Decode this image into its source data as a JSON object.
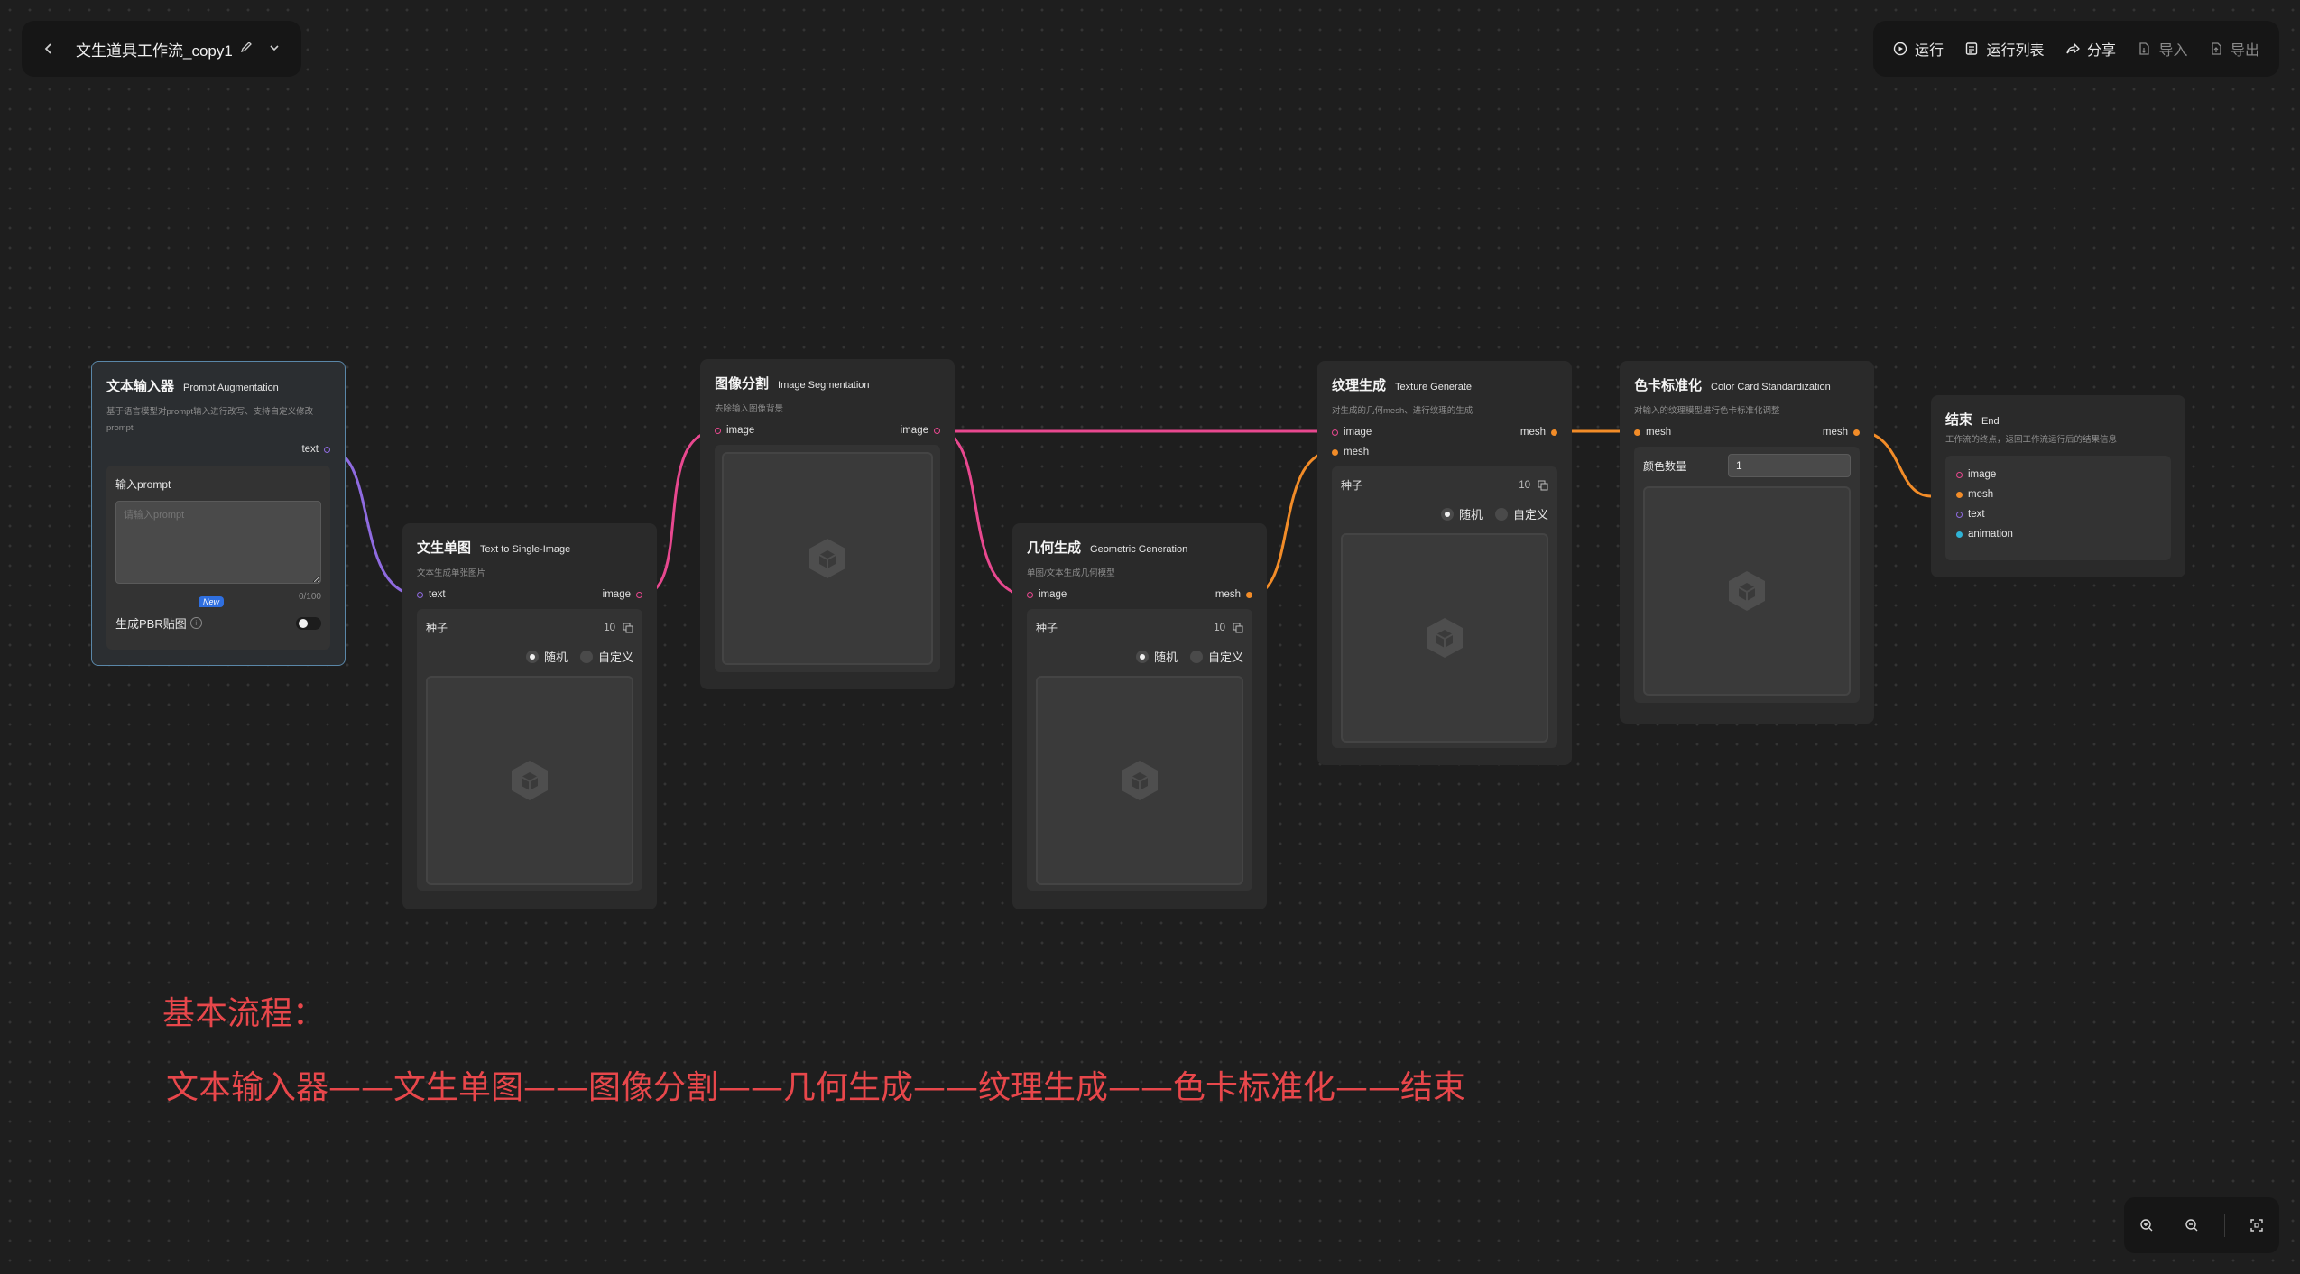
{
  "header": {
    "title": "文生道具工作流_copy1",
    "actions": [
      {
        "label": "运行",
        "icon": "play-circle-icon",
        "enabled": true
      },
      {
        "label": "运行列表",
        "icon": "list-icon",
        "enabled": true
      },
      {
        "label": "分享",
        "icon": "share-icon",
        "enabled": true
      },
      {
        "label": "导入",
        "icon": "import-icon",
        "enabled": false
      },
      {
        "label": "导出",
        "icon": "export-icon",
        "enabled": false
      }
    ]
  },
  "nodes": {
    "prompt": {
      "title": "文本输入器",
      "subtitle": "Prompt Augmentation",
      "desc": "基于语言模型对prompt输入进行改写、支持自定义修改prompt",
      "output": "text",
      "field_label": "输入prompt",
      "placeholder": "请输入prompt",
      "counter": "0/100",
      "pbr_label": "生成PBR贴图",
      "badge": "New",
      "pbr_enabled": false
    },
    "t2i": {
      "title": "文生单图",
      "subtitle": "Text to Single-Image",
      "desc": "文本生成单张图片",
      "input": "text",
      "output": "image",
      "seed_label": "种子",
      "seed_value": "10",
      "opt_random": "随机",
      "opt_custom": "自定义"
    },
    "seg": {
      "title": "图像分割",
      "subtitle": "Image Segmentation",
      "desc": "去除输入图像背景",
      "input": "image",
      "output": "image"
    },
    "geo": {
      "title": "几何生成",
      "subtitle": "Geometric Generation",
      "desc": "单图/文本生成几何模型",
      "input": "image",
      "output": "mesh",
      "seed_label": "种子",
      "seed_value": "10",
      "opt_random": "随机",
      "opt_custom": "自定义"
    },
    "tex": {
      "title": "纹理生成",
      "subtitle": "Texture Generate",
      "desc": "对生成的几何mesh、进行纹理的生成",
      "input1": "image",
      "input2": "mesh",
      "output": "mesh",
      "seed_label": "种子",
      "seed_value": "10",
      "opt_random": "随机",
      "opt_custom": "自定义"
    },
    "color": {
      "title": "色卡标准化",
      "subtitle": "Color Card Standardization",
      "desc": "对输入的纹理模型进行色卡标准化调整",
      "input": "mesh",
      "output": "mesh",
      "count_label": "颜色数量",
      "count_value": "1"
    },
    "end": {
      "title": "结束",
      "subtitle": "End",
      "desc": "工作流的终点，返回工作流运行后的结果信息",
      "outputs": [
        "image",
        "mesh",
        "text",
        "animation"
      ]
    }
  },
  "annotations": {
    "heading": "基本流程：",
    "flow": "文本输入器——文生单图——图像分割——几何生成——纹理生成——色卡标准化——结束"
  },
  "colors": {
    "text_port": "#8f6be0",
    "image_port": "#e8488f",
    "mesh_port": "#f28c28",
    "anim_port": "#2fb3d6",
    "annotation": "#e8474b"
  },
  "zoom_controls": [
    "zoom-in-icon",
    "zoom-out-icon",
    "fit-view-icon"
  ]
}
